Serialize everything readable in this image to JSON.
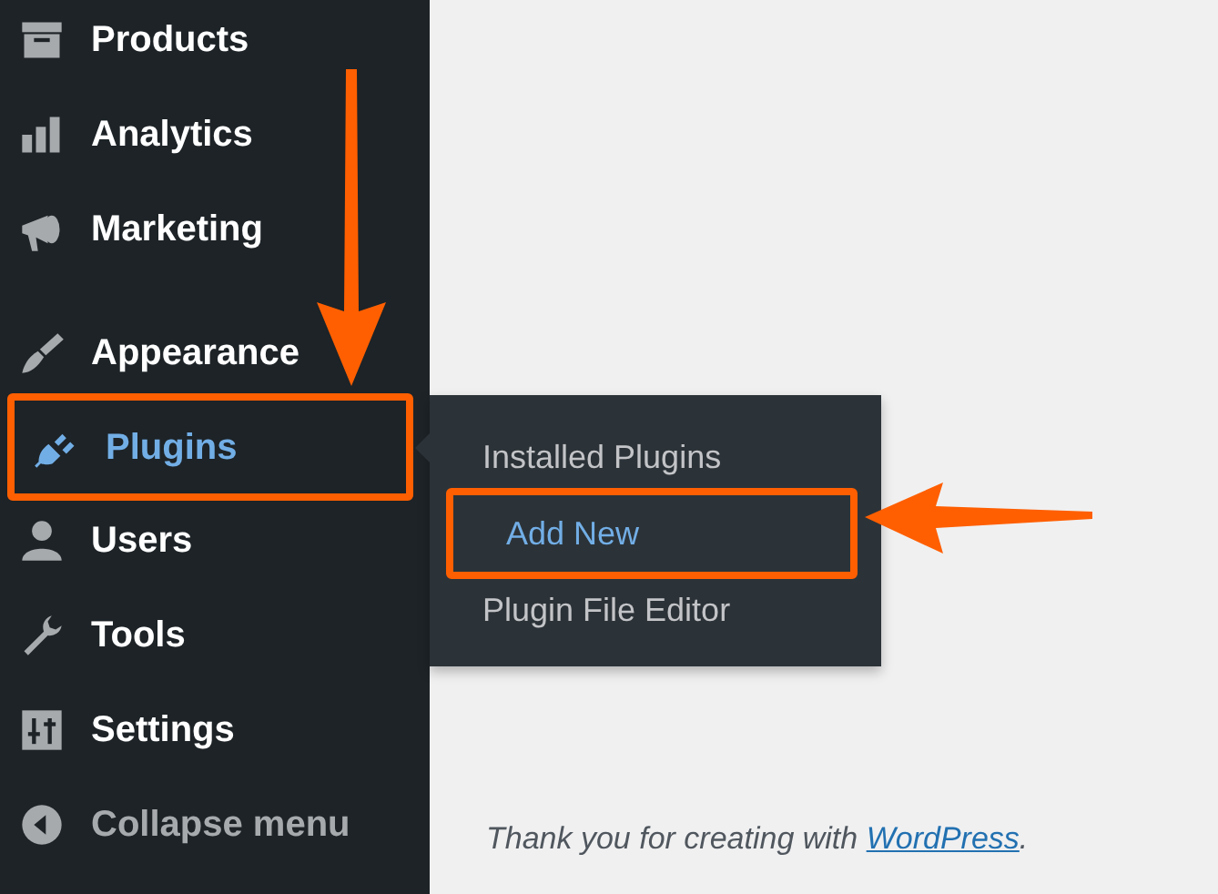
{
  "sidebar": {
    "items": [
      {
        "label": "Products",
        "selected": false,
        "highlighted": false
      },
      {
        "label": "Analytics",
        "selected": false,
        "highlighted": false
      },
      {
        "label": "Marketing",
        "selected": false,
        "highlighted": false,
        "separator_after": true
      },
      {
        "label": "Appearance",
        "selected": false,
        "highlighted": false
      },
      {
        "label": "Plugins",
        "selected": true,
        "highlighted": true,
        "submenu": [
          {
            "label": "Installed Plugins",
            "selected": false,
            "highlighted": false
          },
          {
            "label": "Add New",
            "selected": true,
            "highlighted": true
          },
          {
            "label": "Plugin File Editor",
            "selected": false,
            "highlighted": false
          }
        ]
      },
      {
        "label": "Users",
        "selected": false,
        "highlighted": false
      },
      {
        "label": "Tools",
        "selected": false,
        "highlighted": false
      },
      {
        "label": "Settings",
        "selected": false,
        "highlighted": false
      },
      {
        "label": "Collapse menu",
        "selected": false,
        "highlighted": false,
        "kind": "collapse"
      }
    ]
  },
  "footer": {
    "text": "Thank you for creating with ",
    "link": "WordPress",
    "after": "."
  }
}
